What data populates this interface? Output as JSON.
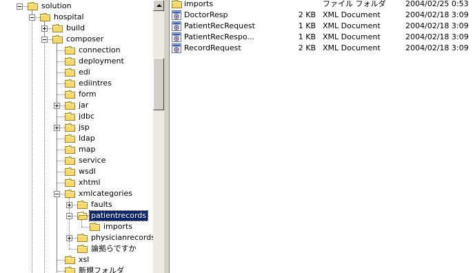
{
  "tree": {
    "nodes": [
      {
        "label": "solution",
        "expander": "minus"
      },
      {
        "label": "hospital",
        "expander": "minus"
      },
      {
        "label": "build",
        "expander": "plus"
      },
      {
        "label": "composer",
        "expander": "minus"
      },
      {
        "label": "connection",
        "expander": ""
      },
      {
        "label": "deployment",
        "expander": ""
      },
      {
        "label": "edi",
        "expander": ""
      },
      {
        "label": "ediintres",
        "expander": ""
      },
      {
        "label": "form",
        "expander": ""
      },
      {
        "label": "jar",
        "expander": "plus"
      },
      {
        "label": "jdbc",
        "expander": ""
      },
      {
        "label": "jsp",
        "expander": "plus"
      },
      {
        "label": "ldap",
        "expander": ""
      },
      {
        "label": "map",
        "expander": ""
      },
      {
        "label": "service",
        "expander": ""
      },
      {
        "label": "wsdl",
        "expander": ""
      },
      {
        "label": "xhtml",
        "expander": ""
      },
      {
        "label": "xmlcategories",
        "expander": "minus"
      },
      {
        "label": "faults",
        "expander": "plus"
      },
      {
        "label": "patientrecords",
        "expander": "minus",
        "selected": true,
        "open": true
      },
      {
        "label": "imports",
        "expander": ""
      },
      {
        "label": "physicianrecords",
        "expander": "plus"
      },
      {
        "label": "論拠らですか",
        "expander": ""
      },
      {
        "label": "xsl",
        "expander": ""
      },
      {
        "label": "新規フォルダ",
        "expander": ""
      }
    ]
  },
  "list": {
    "rows": [
      {
        "icon": "folder-icon",
        "name": "imports",
        "size": "",
        "type": "ファイル フォルダ",
        "date": "2004/02/25 0:53"
      },
      {
        "icon": "xml-icon",
        "name": "DoctorResp",
        "size": "2 KB",
        "type": "XML Document",
        "date": "2004/02/18 3:09"
      },
      {
        "icon": "xml-icon",
        "name": "PatientRecRequest",
        "size": "1 KB",
        "type": "XML Document",
        "date": "2004/02/18 3:09"
      },
      {
        "icon": "xml-icon",
        "name": "PatientRecRespo...",
        "size": "1 KB",
        "type": "XML Document",
        "date": "2004/02/18 3:09"
      },
      {
        "icon": "xml-icon",
        "name": "RecordRequest",
        "size": "2 KB",
        "type": "XML Document",
        "date": "2004/02/18 3:09"
      }
    ]
  },
  "colors": {
    "selection": "#0a246a",
    "folder": "#f7d96b",
    "folderEdge": "#a08020",
    "chrome": "#d4d0c8"
  }
}
